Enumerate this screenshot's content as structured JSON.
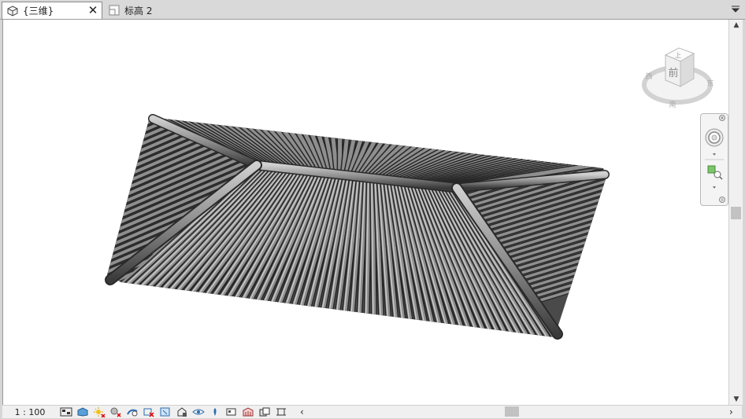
{
  "tabs": [
    {
      "label": "{三维}",
      "icon": "3d-view-icon",
      "active": true
    },
    {
      "label": "标高 2",
      "icon": "floor-plan-icon",
      "active": false
    }
  ],
  "viewcube": {
    "face_top": "上",
    "face_front": "前",
    "compass_west": "西",
    "compass_east": "东",
    "compass_south": "南"
  },
  "status": {
    "scale": "1 : 100"
  },
  "colors": {
    "background": "#ffffff",
    "tile": "#8a8a8a",
    "tile_dark": "#3a3a3a",
    "chrome": "#d9d9d9"
  }
}
